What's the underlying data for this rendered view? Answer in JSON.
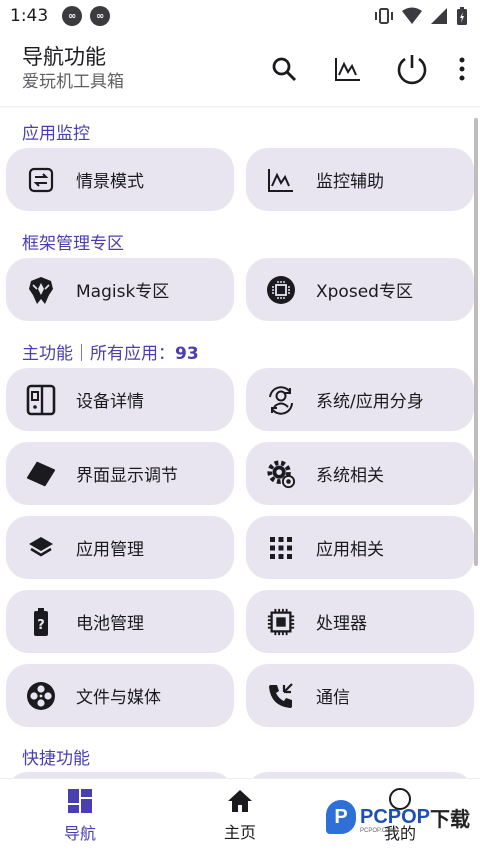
{
  "status_bar": {
    "time": "1:43",
    "notif1": "∞",
    "notif2": "∞"
  },
  "app_bar": {
    "title": "导航功能",
    "subtitle": "爱玩机工具箱"
  },
  "sections": {
    "app_monitor": {
      "title": "应用监控",
      "items": [
        "情景模式",
        "监控辅助"
      ]
    },
    "framework": {
      "title": "框架管理专区",
      "items": [
        "Magisk专区",
        "Xposed专区"
      ]
    },
    "main": {
      "title": "主功能｜所有应用：",
      "count": "93",
      "items": [
        "设备详情",
        "系统/应用分身",
        "界面显示调节",
        "系统相关",
        "应用管理",
        "应用相关",
        "电池管理",
        "处理器",
        "文件与媒体",
        "通信"
      ]
    },
    "shortcuts": {
      "title": "快捷功能"
    }
  },
  "bottom_nav": {
    "items": [
      "导航",
      "主页",
      "我的"
    ]
  },
  "watermark": {
    "logo": "P",
    "text": "PCPOP",
    "dl": "下载",
    "small": "PCPOP.COM"
  },
  "colors": {
    "accent": "#4a3fb1",
    "tile_bg": "#e8e5f1"
  }
}
